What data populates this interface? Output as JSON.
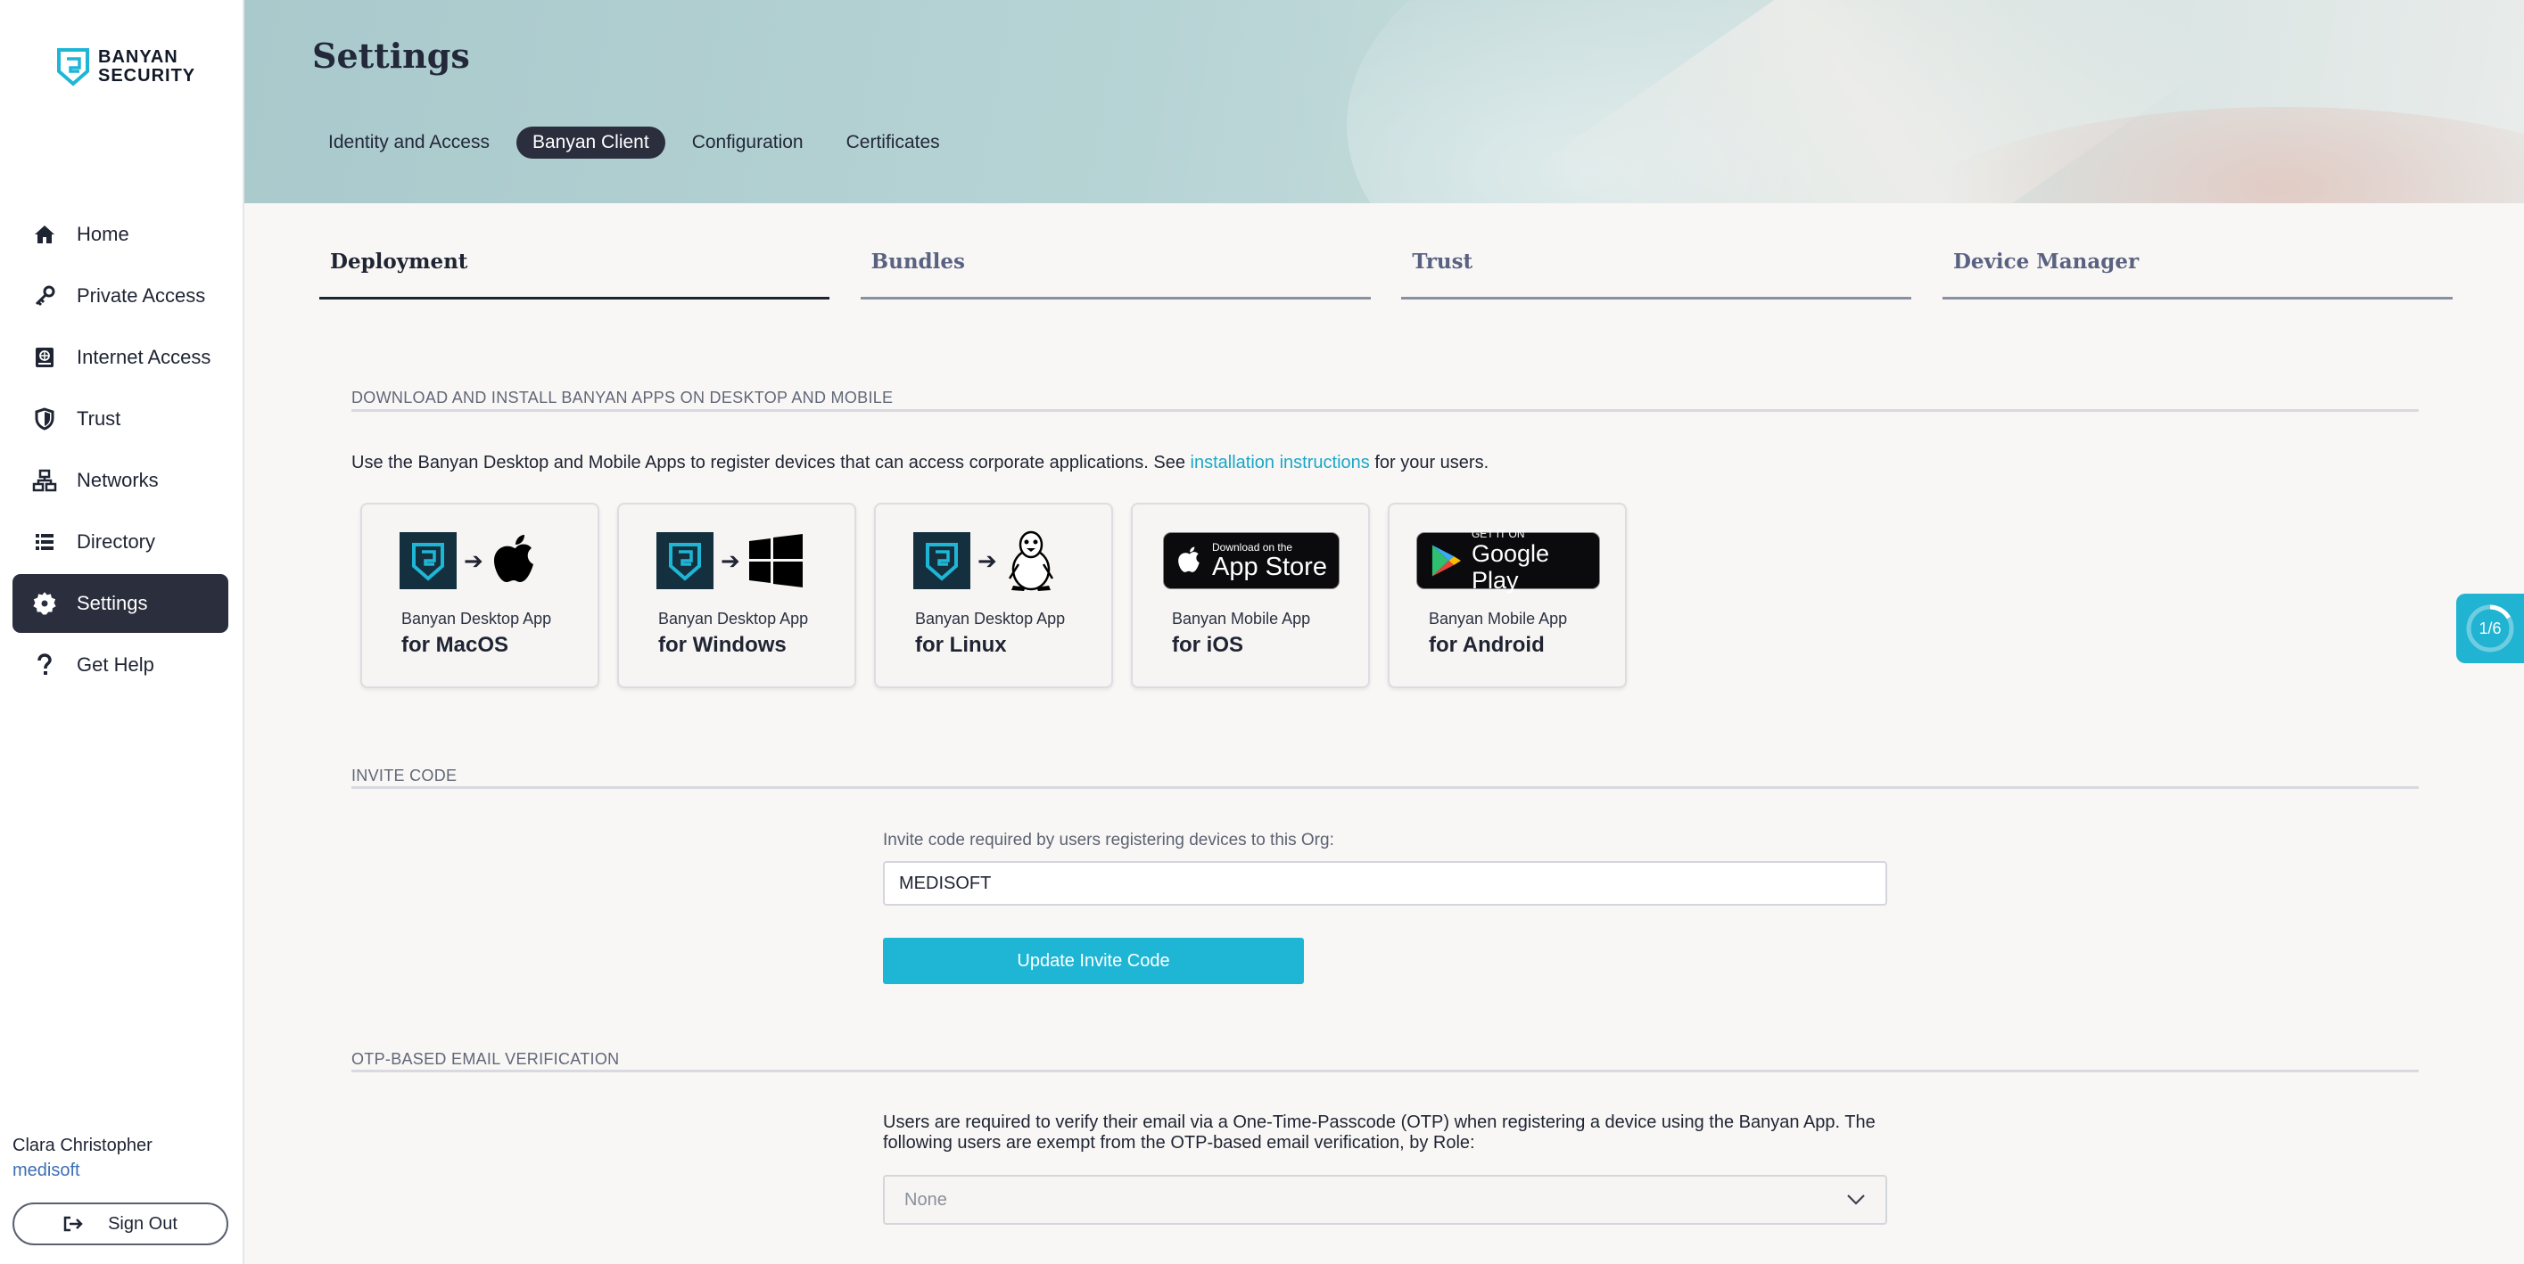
{
  "sidebar": {
    "logo": {
      "line1": "BANYAN",
      "line2": "SECURITY"
    },
    "items": [
      {
        "label": "Home",
        "icon": "home-icon"
      },
      {
        "label": "Private Access",
        "icon": "key-icon"
      },
      {
        "label": "Internet Access",
        "icon": "globe-book-icon"
      },
      {
        "label": "Trust",
        "icon": "shield-icon"
      },
      {
        "label": "Networks",
        "icon": "network-icon"
      },
      {
        "label": "Directory",
        "icon": "list-icon"
      },
      {
        "label": "Settings",
        "icon": "gear-icon",
        "active": true
      },
      {
        "label": "Get Help",
        "icon": "question-icon"
      }
    ],
    "user": {
      "name": "Clara Christopher",
      "org": "medisoft"
    },
    "sign_out": "Sign Out"
  },
  "header": {
    "title": "Settings",
    "tabs": [
      {
        "label": "Identity and Access"
      },
      {
        "label": "Banyan Client",
        "active": true
      },
      {
        "label": "Configuration"
      },
      {
        "label": "Certificates"
      }
    ]
  },
  "sub_tabs": [
    {
      "label": "Deployment",
      "active": true
    },
    {
      "label": "Bundles"
    },
    {
      "label": "Trust"
    },
    {
      "label": "Device Manager"
    }
  ],
  "download": {
    "heading": "DOWNLOAD AND INSTALL BANYAN APPS ON DESKTOP AND MOBILE",
    "desc_before": "Use the Banyan Desktop and Mobile Apps to register devices that can access corporate applications. See ",
    "desc_link": "installation instructions",
    "desc_after": " for your users.",
    "apps": [
      {
        "line1": "Banyan Desktop App",
        "line2": "for MacOS"
      },
      {
        "line1": "Banyan Desktop App",
        "line2": "for Windows"
      },
      {
        "line1": "Banyan Desktop App",
        "line2": "for Linux"
      },
      {
        "line1": "Banyan Mobile App",
        "line2": "for iOS",
        "badge_small": "Download on the",
        "badge_big": "App Store"
      },
      {
        "line1": "Banyan Mobile App",
        "line2": "for Android",
        "badge_small": "GET IT ON",
        "badge_big": "Google Play"
      }
    ]
  },
  "invite": {
    "heading": "INVITE CODE",
    "caption": "Invite code required by users registering devices to this Org:",
    "value": "MEDISOFT",
    "button": "Update Invite Code"
  },
  "otp": {
    "heading": "OTP-BASED EMAIL VERIFICATION",
    "text": "Users are required to verify their email via a One-Time-Passcode (OTP) when registering a device using the Banyan App. The following users are exempt from the OTP-based email verification, by Role:",
    "select_value": "None"
  },
  "progress": {
    "label": "1/6",
    "fraction": 0.1667
  },
  "colors": {
    "accent": "#1fb6d6",
    "active_nav": "#2a2e3d",
    "link": "#1aa7c8"
  }
}
